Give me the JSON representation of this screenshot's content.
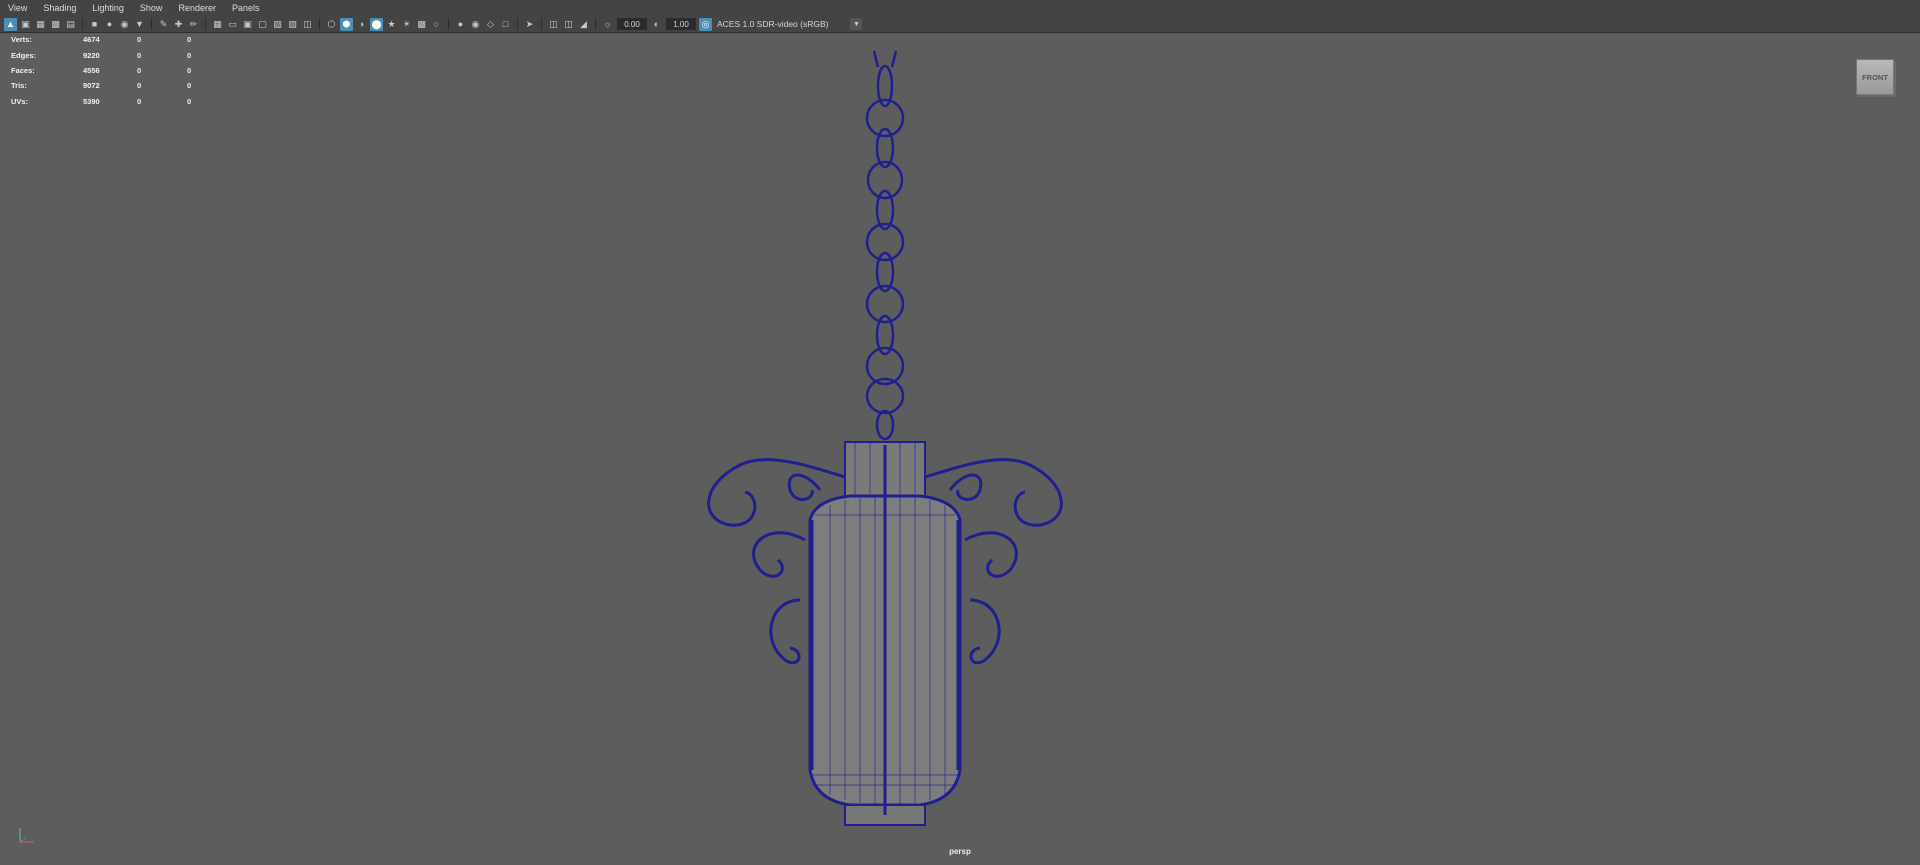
{
  "menus": [
    "View",
    "Shading",
    "Lighting",
    "Show",
    "Renderer",
    "Panels"
  ],
  "toolbar": {
    "exposure": "0.00",
    "gamma": "1.00",
    "color_space": "ACES 1.0 SDR-video (sRGB)",
    "icons_group1": [
      "select-camera-icon",
      "camera-attributes-icon",
      "bookmark-icon",
      "image-plane-icon"
    ],
    "icons_group2": [
      "camera-icon",
      "grease-pencil-icon",
      "2d-pan-zoom-icon",
      "bookmark2-icon"
    ],
    "icons_group3": [
      "grid-icon",
      "film-gate-icon",
      "resolution-gate-icon",
      "gate-mask-icon",
      "field-chart-icon",
      "safe-action-icon"
    ]
  },
  "hud": {
    "rows": [
      {
        "label": "Verts:",
        "v1": "4674",
        "v2": "0",
        "v3": "0"
      },
      {
        "label": "Edges:",
        "v1": "9220",
        "v2": "0",
        "v3": "0"
      },
      {
        "label": "Faces:",
        "v1": "4556",
        "v2": "0",
        "v3": "0"
      },
      {
        "label": "Tris:",
        "v1": "9072",
        "v2": "0",
        "v3": "0"
      },
      {
        "label": "UVs:",
        "v1": "5390",
        "v2": "0",
        "v3": "0"
      }
    ]
  },
  "viewcube_label": "FRONT",
  "camera_label": "persp",
  "colors": {
    "viewport_bg": "#5d5d5d",
    "wire": "#1f1f8f",
    "accent": "#4a8fb5"
  }
}
